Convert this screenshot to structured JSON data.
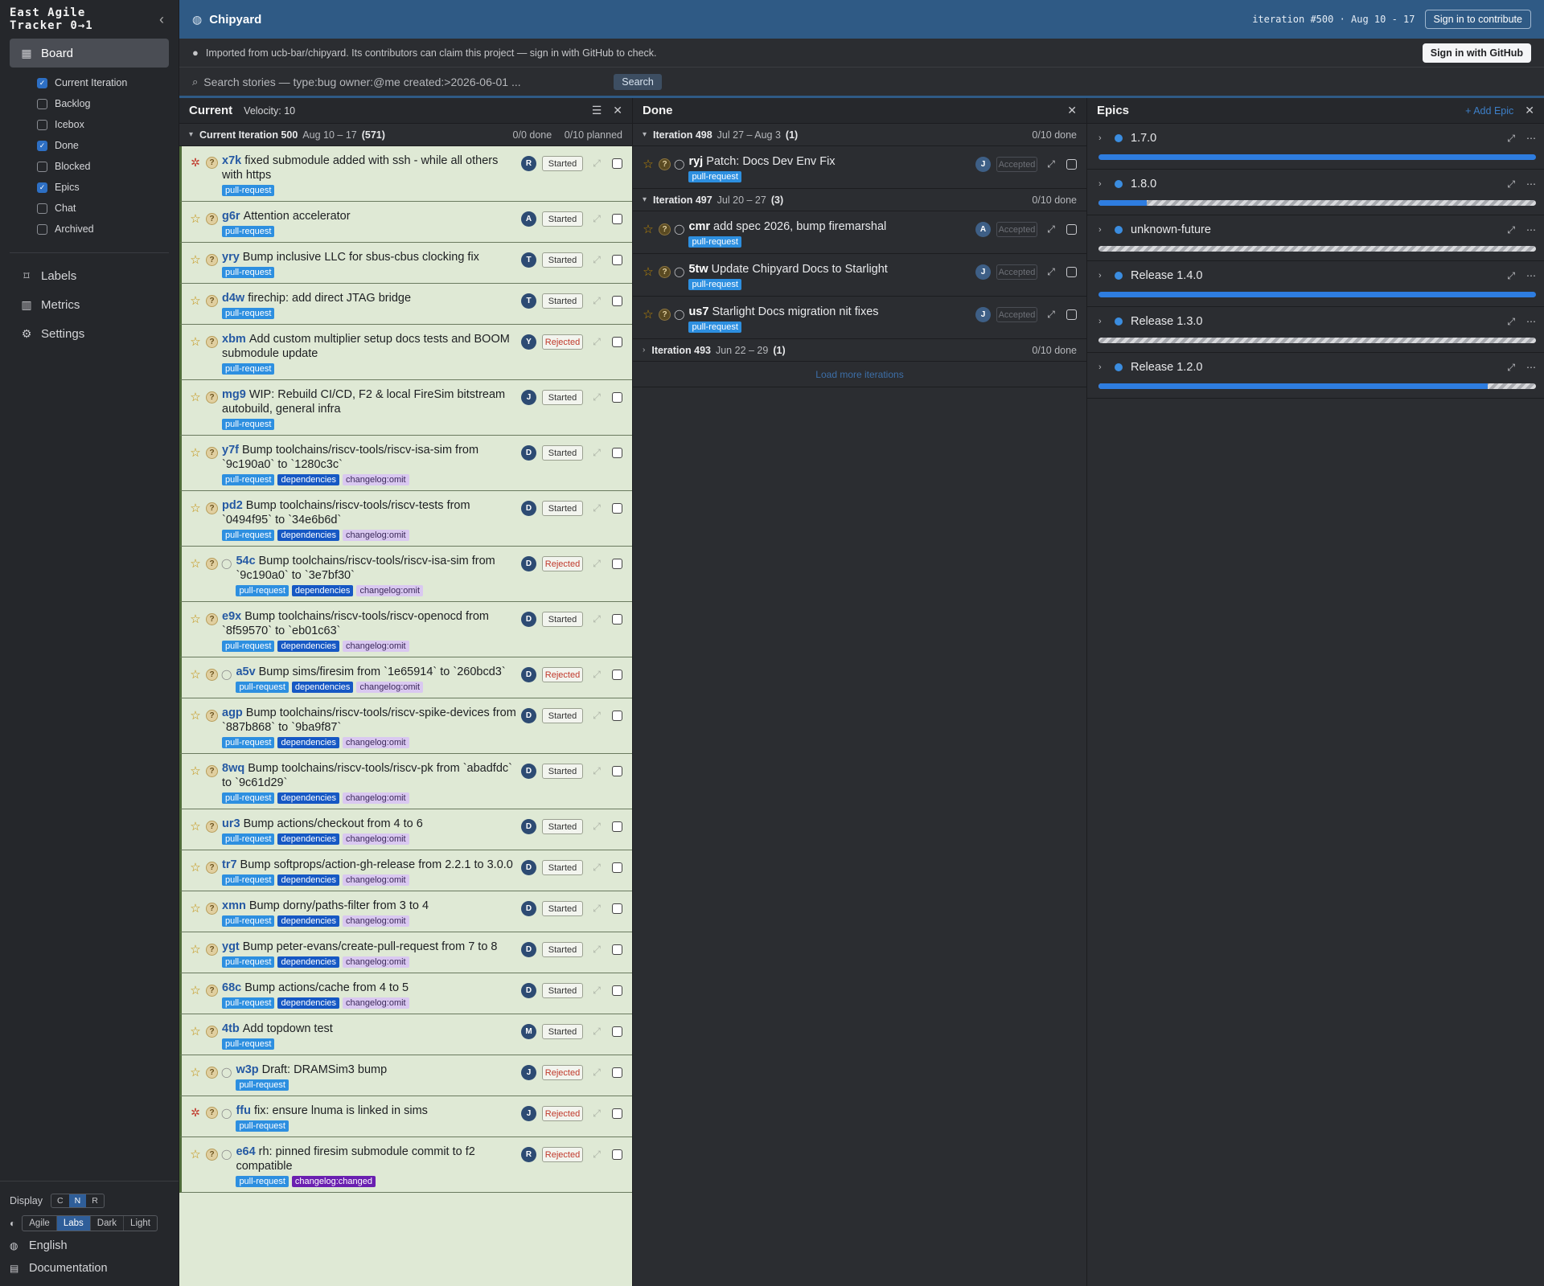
{
  "brand": {
    "line1": "East Agile",
    "line2": "Tracker 0→1"
  },
  "sidebar": {
    "board_label": "Board",
    "board_items": [
      {
        "label": "Current Iteration",
        "checked": true
      },
      {
        "label": "Backlog",
        "checked": false
      },
      {
        "label": "Icebox",
        "checked": false
      },
      {
        "label": "Done",
        "checked": true
      },
      {
        "label": "Blocked",
        "checked": false
      },
      {
        "label": "Epics",
        "checked": true
      },
      {
        "label": "Chat",
        "checked": false
      },
      {
        "label": "Archived",
        "checked": false
      }
    ],
    "labels_label": "Labels",
    "metrics_label": "Metrics",
    "settings_label": "Settings",
    "display_label": "Display",
    "display_modes": [
      "C",
      "N",
      "R"
    ],
    "display_selected": "N",
    "themes": [
      "Agile",
      "Labs",
      "Dark",
      "Light"
    ],
    "theme_selected": "Labs",
    "language_label": "English",
    "docs_label": "Documentation"
  },
  "topbar": {
    "project": "Chipyard",
    "iteration_info": "iteration #500 · Aug 10 - 17",
    "sign_in_contribute": "Sign in to contribute"
  },
  "infobar": {
    "text": "Imported from ucb-bar/chipyard. Its contributors can claim this project — sign in with GitHub to check.",
    "button": "Sign in with GitHub"
  },
  "search": {
    "placeholder": "Search stories — type:bug owner:@me created:>2026-06-01 ...",
    "button": "Search"
  },
  "current": {
    "title": "Current",
    "velocity": "Velocity: 10",
    "iteration_label": "Current Iteration 500",
    "iteration_dates": "Aug 10 – 17",
    "iteration_count": "(571)",
    "done_text": "0/0 done",
    "planned_text": "0/10 planned",
    "stories": [
      {
        "id": "x7k",
        "title": "fixed submodule added with ssh - while all others with https",
        "labels": [
          "pull-request"
        ],
        "owner": "R",
        "state": "Started",
        "type": "bug",
        "chat": false
      },
      {
        "id": "g6r",
        "title": "Attention accelerator",
        "labels": [
          "pull-request"
        ],
        "owner": "A",
        "state": "Started",
        "type": "feature",
        "chat": false
      },
      {
        "id": "yry",
        "title": "Bump inclusive LLC for sbus-cbus clocking fix",
        "labels": [
          "pull-request"
        ],
        "owner": "T",
        "state": "Started",
        "type": "feature",
        "chat": false
      },
      {
        "id": "d4w",
        "title": "firechip: add direct JTAG bridge",
        "labels": [
          "pull-request"
        ],
        "owner": "T",
        "state": "Started",
        "type": "feature",
        "chat": false
      },
      {
        "id": "xbm",
        "title": "Add custom multiplier setup docs tests and BOOM submodule update",
        "labels": [
          "pull-request"
        ],
        "owner": "Y",
        "state": "Rejected",
        "type": "feature",
        "chat": false
      },
      {
        "id": "mg9",
        "title": "WIP: Rebuild CI/CD, F2 & local FireSim bitstream autobuild, general infra",
        "labels": [
          "pull-request"
        ],
        "owner": "J",
        "state": "Started",
        "type": "feature",
        "chat": false
      },
      {
        "id": "y7f",
        "title": "Bump toolchains/riscv-tools/riscv-isa-sim from `9c190a0` to `1280c3c`",
        "labels": [
          "pull-request",
          "dependencies",
          "changelog:omit"
        ],
        "owner": "D",
        "state": "Started",
        "type": "feature",
        "chat": false
      },
      {
        "id": "pd2",
        "title": "Bump toolchains/riscv-tools/riscv-tests from `0494f95` to `34e6b6d`",
        "labels": [
          "pull-request",
          "dependencies",
          "changelog:omit"
        ],
        "owner": "D",
        "state": "Started",
        "type": "feature",
        "chat": false
      },
      {
        "id": "54c",
        "title": "Bump toolchains/riscv-tools/riscv-isa-sim from `9c190a0` to `3e7bf30`",
        "labels": [
          "pull-request",
          "dependencies",
          "changelog:omit"
        ],
        "owner": "D",
        "state": "Rejected",
        "type": "feature",
        "chat": true
      },
      {
        "id": "e9x",
        "title": "Bump toolchains/riscv-tools/riscv-openocd from `8f59570` to `eb01c63`",
        "labels": [
          "pull-request",
          "dependencies",
          "changelog:omit"
        ],
        "owner": "D",
        "state": "Started",
        "type": "feature",
        "chat": false
      },
      {
        "id": "a5v",
        "title": "Bump sims/firesim from `1e65914` to `260bcd3`",
        "labels": [
          "pull-request",
          "dependencies",
          "changelog:omit"
        ],
        "owner": "D",
        "state": "Rejected",
        "type": "feature",
        "chat": true
      },
      {
        "id": "agp",
        "title": "Bump toolchains/riscv-tools/riscv-spike-devices from `887b868` to `9ba9f87`",
        "labels": [
          "pull-request",
          "dependencies",
          "changelog:omit"
        ],
        "owner": "D",
        "state": "Started",
        "type": "feature",
        "chat": false
      },
      {
        "id": "8wq",
        "title": "Bump toolchains/riscv-tools/riscv-pk from `abadfdc` to `9c61d29`",
        "labels": [
          "pull-request",
          "dependencies",
          "changelog:omit"
        ],
        "owner": "D",
        "state": "Started",
        "type": "feature",
        "chat": false
      },
      {
        "id": "ur3",
        "title": "Bump actions/checkout from 4 to 6",
        "labels": [
          "pull-request",
          "dependencies",
          "changelog:omit"
        ],
        "owner": "D",
        "state": "Started",
        "type": "feature",
        "chat": false
      },
      {
        "id": "tr7",
        "title": "Bump softprops/action-gh-release from 2.2.1 to 3.0.0",
        "labels": [
          "pull-request",
          "dependencies",
          "changelog:omit"
        ],
        "owner": "D",
        "state": "Started",
        "type": "feature",
        "chat": false
      },
      {
        "id": "xmn",
        "title": "Bump dorny/paths-filter from 3 to 4",
        "labels": [
          "pull-request",
          "dependencies",
          "changelog:omit"
        ],
        "owner": "D",
        "state": "Started",
        "type": "feature",
        "chat": false
      },
      {
        "id": "ygt",
        "title": "Bump peter-evans/create-pull-request from 7 to 8",
        "labels": [
          "pull-request",
          "dependencies",
          "changelog:omit"
        ],
        "owner": "D",
        "state": "Started",
        "type": "feature",
        "chat": false
      },
      {
        "id": "68c",
        "title": "Bump actions/cache from 4 to 5",
        "labels": [
          "pull-request",
          "dependencies",
          "changelog:omit"
        ],
        "owner": "D",
        "state": "Started",
        "type": "feature",
        "chat": false
      },
      {
        "id": "4tb",
        "title": "Add topdown test",
        "labels": [
          "pull-request"
        ],
        "owner": "M",
        "state": "Started",
        "type": "feature",
        "chat": false
      },
      {
        "id": "w3p",
        "title": "Draft: DRAMSim3 bump",
        "labels": [
          "pull-request"
        ],
        "owner": "J",
        "state": "Rejected",
        "type": "feature",
        "chat": true
      },
      {
        "id": "ffu",
        "title": "fix: ensure lnuma is linked in sims",
        "labels": [
          "pull-request"
        ],
        "owner": "J",
        "state": "Rejected",
        "type": "bug",
        "chat": true
      },
      {
        "id": "e64",
        "title": "rh: pinned firesim submodule commit to f2 compatible",
        "labels": [
          "pull-request",
          "changelog:changed"
        ],
        "owner": "R",
        "state": "Rejected",
        "type": "feature",
        "chat": true
      }
    ]
  },
  "done": {
    "title": "Done",
    "iterations": [
      {
        "label": "Iteration 498",
        "dates": "Jul 27 – Aug 3",
        "count": "(1)",
        "done": "0/10 done",
        "expanded": true,
        "stories": [
          {
            "id": "ryj",
            "title": "Patch: Docs Dev Env Fix",
            "labels": [
              "pull-request"
            ],
            "owner": "J",
            "state": "Accepted"
          }
        ]
      },
      {
        "label": "Iteration 497",
        "dates": "Jul 20 – 27",
        "count": "(3)",
        "done": "0/10 done",
        "expanded": true,
        "stories": [
          {
            "id": "cmr",
            "title": "add spec 2026, bump firemarshal",
            "labels": [
              "pull-request"
            ],
            "owner": "A",
            "state": "Accepted"
          },
          {
            "id": "5tw",
            "title": "Update Chipyard Docs to Starlight",
            "labels": [
              "pull-request"
            ],
            "owner": "J",
            "state": "Accepted"
          },
          {
            "id": "us7",
            "title": "Starlight Docs migration nit fixes",
            "labels": [
              "pull-request"
            ],
            "owner": "J",
            "state": "Accepted"
          }
        ]
      },
      {
        "label": "Iteration 493",
        "dates": "Jun 22 – 29",
        "count": "(1)",
        "done": "0/10 done",
        "expanded": false,
        "stories": []
      }
    ],
    "load_more": "Load more iterations"
  },
  "epics": {
    "title": "Epics",
    "add_label": "+ Add Epic",
    "items": [
      {
        "name": "1.7.0",
        "progress": 1.0
      },
      {
        "name": "1.8.0",
        "progress": 0.11
      },
      {
        "name": "unknown-future",
        "progress": 0.0
      },
      {
        "name": "Release 1.4.0",
        "progress": 1.0
      },
      {
        "name": "Release 1.3.0",
        "progress": 0.0
      },
      {
        "name": "Release 1.2.0",
        "progress": 0.89
      }
    ]
  }
}
